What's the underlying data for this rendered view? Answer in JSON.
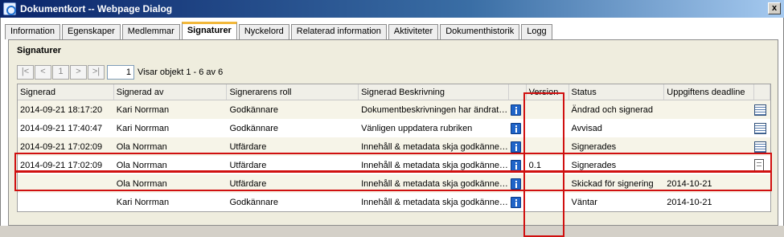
{
  "window": {
    "title": "Dokumentkort -- Webpage Dialog",
    "close_symbol": "x",
    "icon": "ie-icon"
  },
  "tabs": [
    {
      "label": "Information",
      "active": false
    },
    {
      "label": "Egenskaper",
      "active": false
    },
    {
      "label": "Medlemmar",
      "active": false
    },
    {
      "label": "Signaturer",
      "active": true
    },
    {
      "label": "Nyckelord",
      "active": false
    },
    {
      "label": "Relaterad information",
      "active": false
    },
    {
      "label": "Aktiviteter",
      "active": false
    },
    {
      "label": "Dokumenthistorik",
      "active": false
    },
    {
      "label": "Logg",
      "active": false
    }
  ],
  "panel": {
    "title": "Signaturer"
  },
  "pager": {
    "first": "|<",
    "prev": "<",
    "page_box": "1",
    "next": ">",
    "last": ">|",
    "current_page": "1",
    "summary": "Visar objekt 1 - 6 av 6"
  },
  "grid": {
    "headers": {
      "signerad": "Signerad",
      "signerad_av": "Signerad av",
      "roll": "Signerarens roll",
      "beskrivning": "Signerad Beskrivning",
      "version": "Version",
      "status": "Status",
      "deadline": "Uppgiftens deadline"
    },
    "rows": [
      {
        "signerad": "2014-09-21 18:17:20",
        "signerad_av": "Kari Norrman",
        "roll": "Godkännare",
        "beskrivning": "Dokumentbeskrivningen har ändrat…",
        "version": "",
        "status": "Ändrad och signerad",
        "deadline": "",
        "action_icon": "grid-icon"
      },
      {
        "signerad": "2014-09-21 17:40:47",
        "signerad_av": "Kari Norrman",
        "roll": "Godkännare",
        "beskrivning": "Vänligen uppdatera rubriken",
        "version": "",
        "status": "Avvisad",
        "deadline": "",
        "action_icon": "grid-icon"
      },
      {
        "signerad": "2014-09-21 17:02:09",
        "signerad_av": "Ola Norrman",
        "roll": "Utfärdare",
        "beskrivning": "Innehåll & metadata skja godkänne…",
        "version": "",
        "status": "Signerades",
        "deadline": "",
        "action_icon": "grid-icon"
      },
      {
        "signerad": "2014-09-21 17:02:09",
        "signerad_av": "Ola Norrman",
        "roll": "Utfärdare",
        "beskrivning": "Innehåll & metadata skja godkänne…",
        "version": "0.1",
        "status": "Signerades",
        "deadline": "",
        "action_icon": "document-icon"
      },
      {
        "signerad": "",
        "signerad_av": "Ola Norrman",
        "roll": "Utfärdare",
        "beskrivning": "Innehåll & metadata skja godkänne…",
        "version": "",
        "status": "Skickad för signering",
        "deadline": "2014-10-21",
        "action_icon": ""
      },
      {
        "signerad": "",
        "signerad_av": "Kari Norrman",
        "roll": "Godkännare",
        "beskrivning": "Innehåll & metadata skja godkänne…",
        "version": "",
        "status": "Väntar",
        "deadline": "2014-10-21",
        "action_icon": ""
      }
    ]
  },
  "colors": {
    "highlight_outline": "#d01010",
    "active_tab_accent": "#f2b83b",
    "panel_background": "#efedde"
  }
}
